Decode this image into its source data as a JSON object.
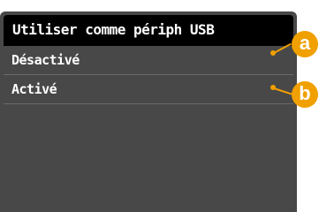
{
  "screen": {
    "title": "Utiliser comme périph USB",
    "items": [
      {
        "label": "Désactivé"
      },
      {
        "label": "Activé"
      }
    ]
  },
  "callouts": [
    {
      "letter": "a"
    },
    {
      "letter": "b"
    }
  ],
  "colors": {
    "callout": "#f0a000",
    "screen_bg": "#484848",
    "title_bg": "#000000",
    "text": "#ffffff"
  }
}
